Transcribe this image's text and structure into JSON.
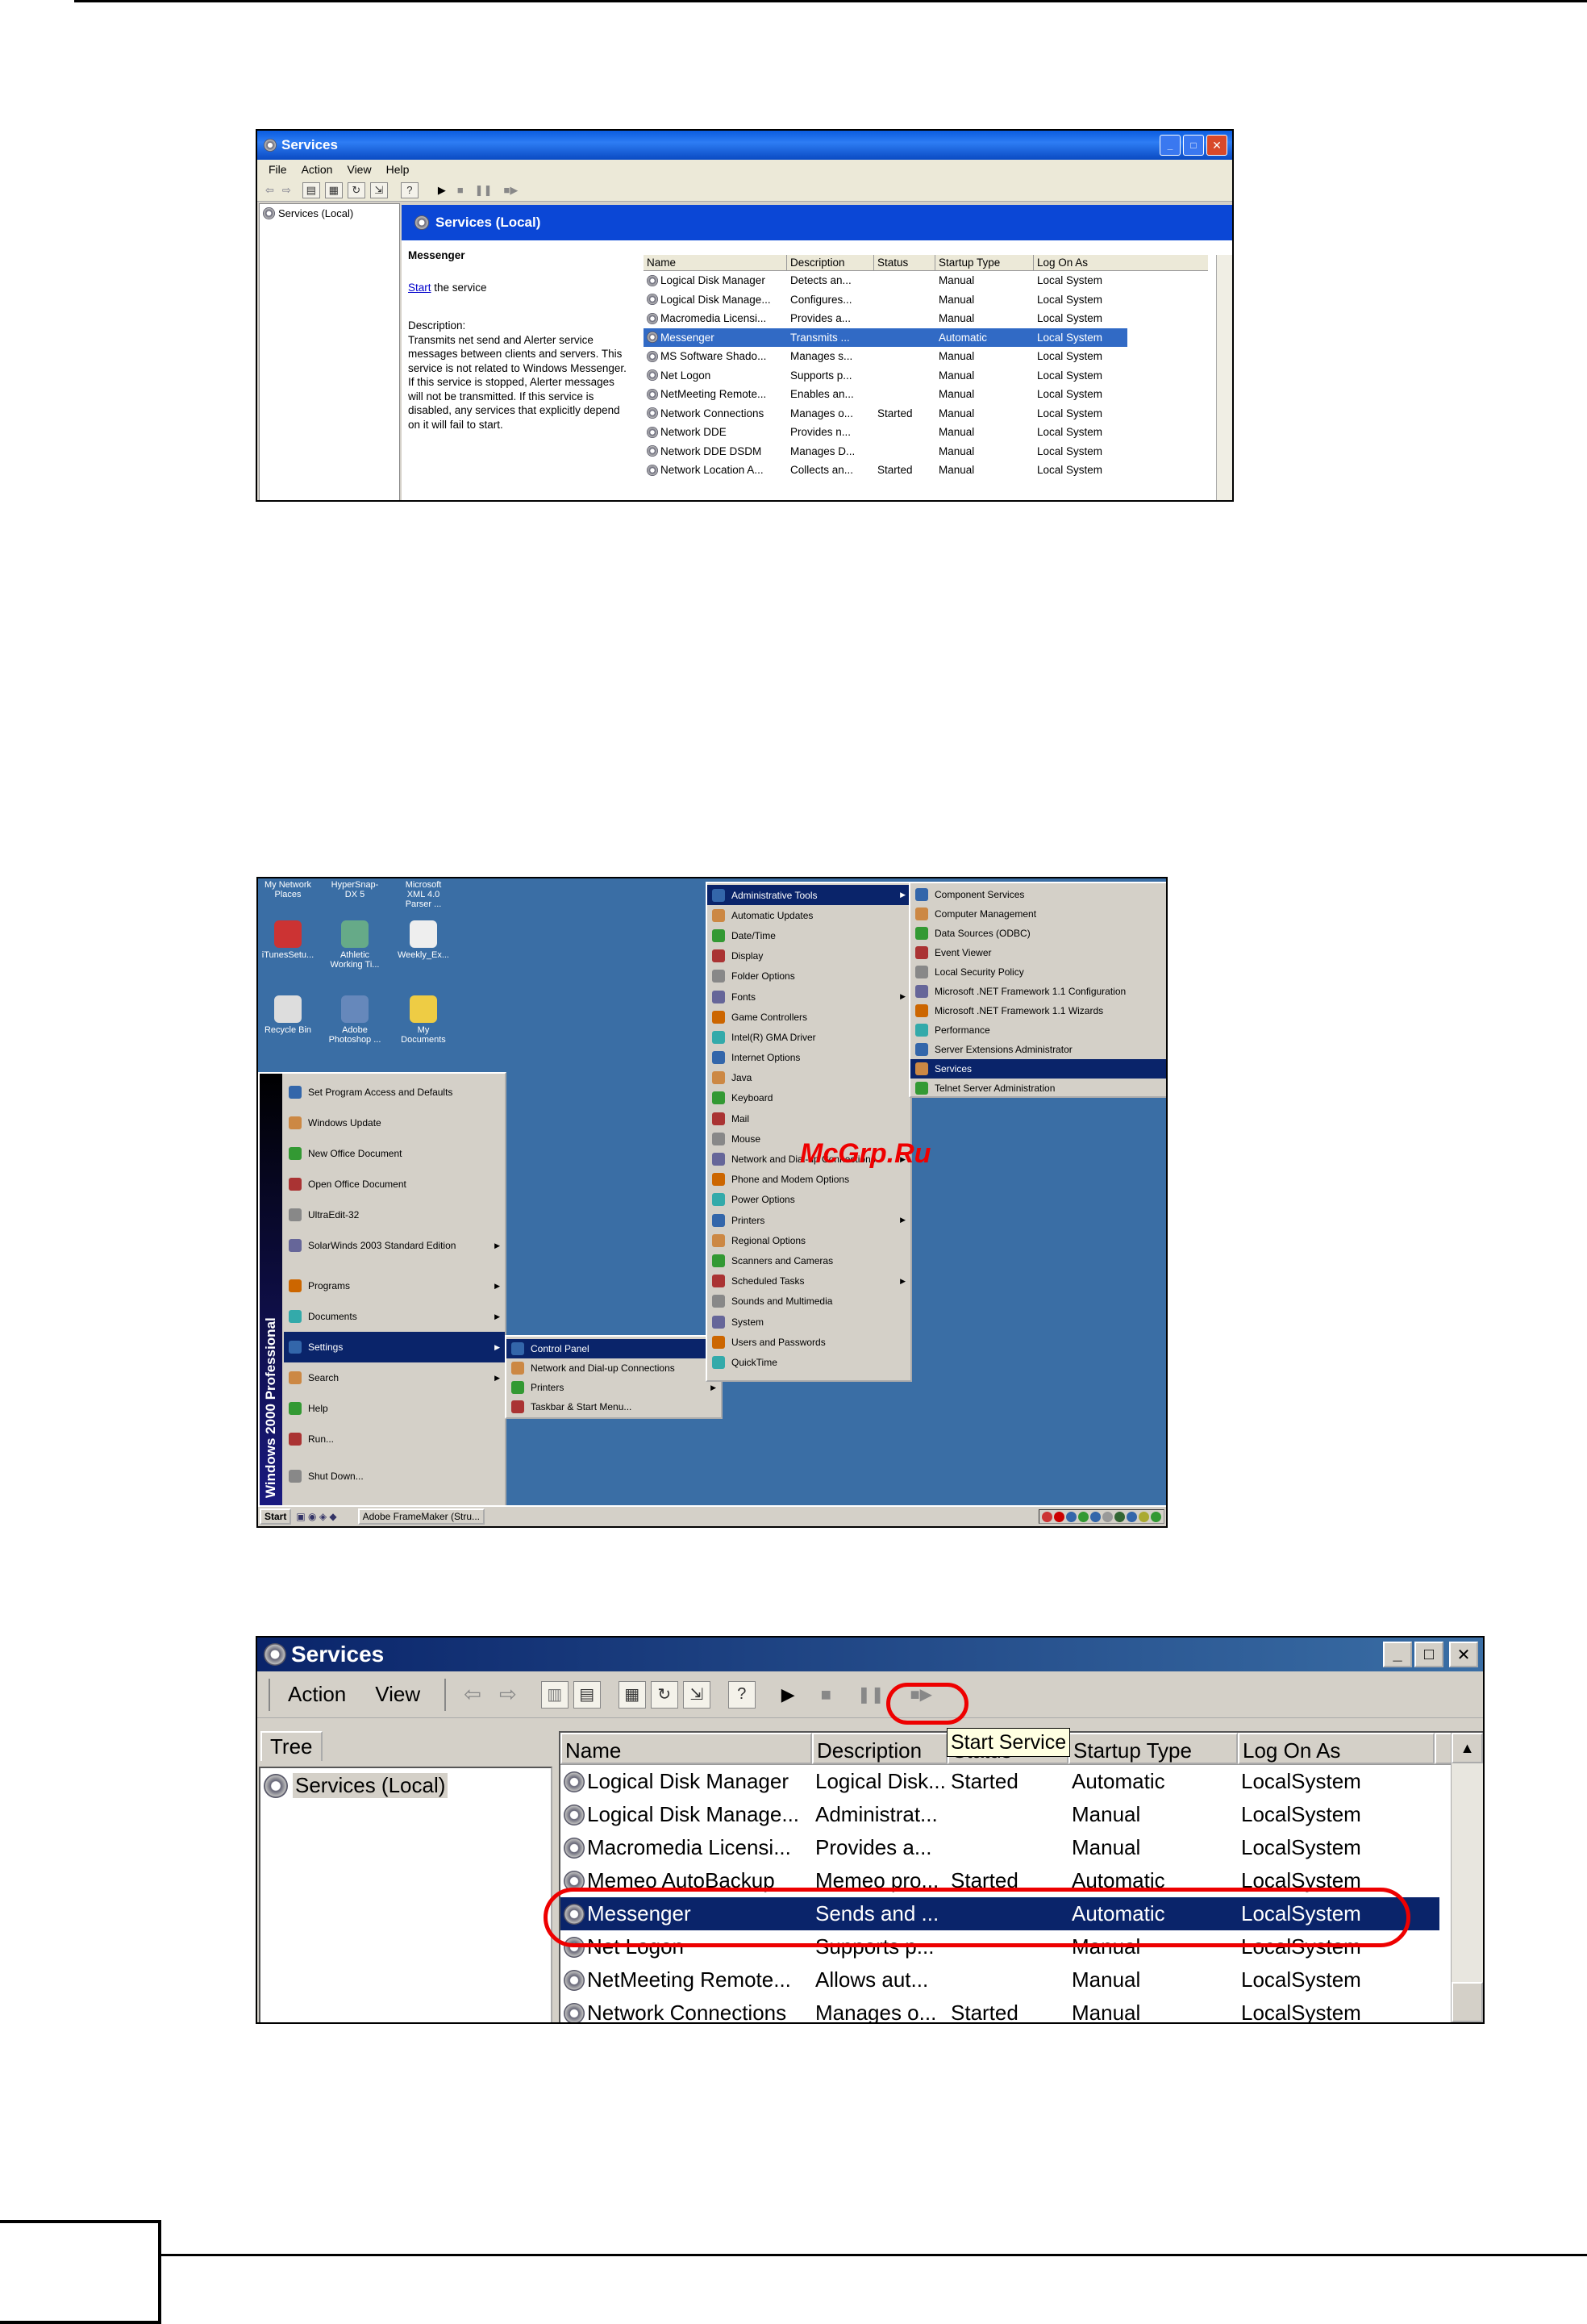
{
  "shot1": {
    "title": "Services",
    "menu": [
      "File",
      "Action",
      "View",
      "Help"
    ],
    "tree_item": "Services (Local)",
    "banner": "Services (Local)",
    "desc_title": "Messenger",
    "desc_start_link": "Start",
    "desc_start_rest": " the service",
    "desc_label": "Description:",
    "desc_text": "Transmits net send and Alerter service messages between clients and servers. This service is not related to Windows Messenger. If this service is stopped, Alerter messages will not be transmitted. If this service is disabled, any services that explicitly depend on it will fail to start.",
    "columns": [
      "Name",
      "Description",
      "Status",
      "Startup Type",
      "Log On As"
    ],
    "rows": [
      {
        "name": "Logical Disk Manager",
        "desc": "Detects an...",
        "status": "",
        "startup": "Manual",
        "logon": "Local System"
      },
      {
        "name": "Logical Disk Manage...",
        "desc": "Configures...",
        "status": "",
        "startup": "Manual",
        "logon": "Local System"
      },
      {
        "name": "Macromedia Licensi...",
        "desc": "Provides a...",
        "status": "",
        "startup": "Manual",
        "logon": "Local System"
      },
      {
        "name": "Messenger",
        "desc": "Transmits ...",
        "status": "",
        "startup": "Automatic",
        "logon": "Local System"
      },
      {
        "name": "MS Software Shado...",
        "desc": "Manages s...",
        "status": "",
        "startup": "Manual",
        "logon": "Local System"
      },
      {
        "name": "Net Logon",
        "desc": "Supports p...",
        "status": "",
        "startup": "Manual",
        "logon": "Local System"
      },
      {
        "name": "NetMeeting Remote...",
        "desc": "Enables an...",
        "status": "",
        "startup": "Manual",
        "logon": "Local System"
      },
      {
        "name": "Network Connections",
        "desc": "Manages o...",
        "status": "Started",
        "startup": "Manual",
        "logon": "Local System"
      },
      {
        "name": "Network DDE",
        "desc": "Provides n...",
        "status": "",
        "startup": "Manual",
        "logon": "Local System"
      },
      {
        "name": "Network DDE DSDM",
        "desc": "Manages D...",
        "status": "",
        "startup": "Manual",
        "logon": "Local System"
      },
      {
        "name": "Network Location A...",
        "desc": "Collects an...",
        "status": "Started",
        "startup": "Manual",
        "logon": "Local System"
      }
    ]
  },
  "shot2": {
    "desktop_icons": [
      {
        "label": "My Network Places"
      },
      {
        "label": "HyperSnap-DX 5"
      },
      {
        "label": "Microsoft XML 4.0 Parser ..."
      },
      {
        "label": "iTunesSetu..."
      },
      {
        "label": "Athletic Working Ti..."
      },
      {
        "label": "Weekly_Ex..."
      },
      {
        "label": "Recycle Bin"
      },
      {
        "label": "Adobe Photoshop ..."
      },
      {
        "label": "My Documents"
      }
    ],
    "start_side_text": "Windows 2000 Professional",
    "start_menu": [
      "Set Program Access and Defaults",
      "Windows Update",
      "New Office Document",
      "Open Office Document",
      "UltraEdit-32",
      "SolarWinds 2003 Standard Edition",
      "Programs",
      "Documents",
      "Settings",
      "Search",
      "Help",
      "Run...",
      "Shut Down..."
    ],
    "settings_menu": [
      "Control Panel",
      "Network and Dial-up Connections",
      "Printers",
      "Taskbar & Start Menu..."
    ],
    "control_panel": [
      "Administrative Tools",
      "Automatic Updates",
      "Date/Time",
      "Display",
      "Folder Options",
      "Fonts",
      "Game Controllers",
      "Intel(R) GMA Driver",
      "Internet Options",
      "Java",
      "Keyboard",
      "Mail",
      "Mouse",
      "Network and Dial-up Connections",
      "Phone and Modem Options",
      "Power Options",
      "Printers",
      "Regional Options",
      "Scanners and Cameras",
      "Scheduled Tasks",
      "Sounds and Multimedia",
      "System",
      "Users and Passwords",
      "QuickTime"
    ],
    "admin_tools": [
      "Component Services",
      "Computer Management",
      "Data Sources (ODBC)",
      "Event Viewer",
      "Local Security Policy",
      "Microsoft .NET Framework 1.1 Configuration",
      "Microsoft .NET Framework 1.1 Wizards",
      "Performance",
      "Server Extensions Administrator",
      "Services",
      "Telnet Server Administration"
    ],
    "taskbar_start": "Start",
    "taskbar_task": "Adobe FrameMaker (Stru...",
    "watermark": "McGrp.Ru"
  },
  "shot3": {
    "title": "Services",
    "menu": [
      "Action",
      "View"
    ],
    "tree_tab": "Tree",
    "tree_item": "Services (Local)",
    "tooltip": "Start Service",
    "columns": [
      "Name",
      "Description",
      "Status",
      "Startup Type",
      "Log On As"
    ],
    "rows": [
      {
        "name": "Logical Disk Manager",
        "desc": "Logical Disk...",
        "status": "Started",
        "startup": "Automatic",
        "logon": "LocalSystem"
      },
      {
        "name": "Logical Disk Manage...",
        "desc": "Administrat...",
        "status": "",
        "startup": "Manual",
        "logon": "LocalSystem"
      },
      {
        "name": "Macromedia Licensi...",
        "desc": "Provides a...",
        "status": "",
        "startup": "Manual",
        "logon": "LocalSystem"
      },
      {
        "name": "Memeo AutoBackup",
        "desc": "Memeo pro...",
        "status": "Started",
        "startup": "Automatic",
        "logon": "LocalSystem"
      },
      {
        "name": "Messenger",
        "desc": "Sends and ...",
        "status": "",
        "startup": "Automatic",
        "logon": "LocalSystem"
      },
      {
        "name": "Net Logon",
        "desc": "Supports p...",
        "status": "",
        "startup": "Manual",
        "logon": "LocalSystem"
      },
      {
        "name": "NetMeeting Remote...",
        "desc": "Allows aut...",
        "status": "",
        "startup": "Manual",
        "logon": "LocalSystem"
      },
      {
        "name": "Network Connections",
        "desc": "Manages o...",
        "status": "Started",
        "startup": "Manual",
        "logon": "LocalSystem"
      }
    ]
  }
}
